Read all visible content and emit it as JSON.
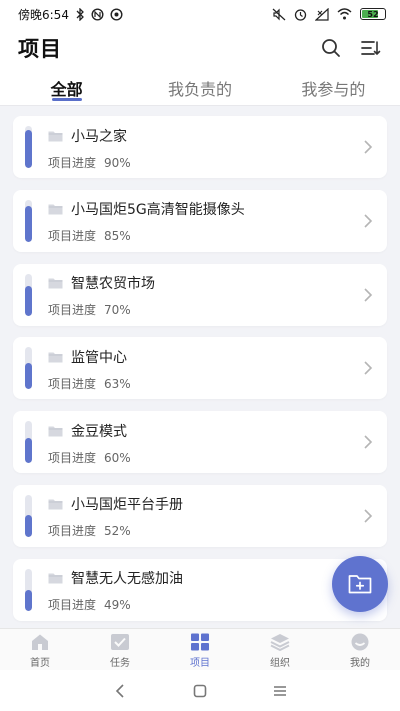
{
  "status_bar": {
    "time": "傍晚6:54",
    "battery": "52"
  },
  "header": {
    "title": "项目"
  },
  "tabs": [
    {
      "label": "全部",
      "active": true
    },
    {
      "label": "我负责的",
      "active": false
    },
    {
      "label": "我参与的",
      "active": false
    }
  ],
  "projects": [
    {
      "name": "小马之家",
      "progress_label": "项目进度",
      "progress": "90%",
      "progress_value": 90
    },
    {
      "name": "小马国炬5G高清智能摄像头",
      "progress_label": "项目进度",
      "progress": "85%",
      "progress_value": 85
    },
    {
      "name": "智慧农贸市场",
      "progress_label": "项目进度",
      "progress": "70%",
      "progress_value": 70
    },
    {
      "name": "监管中心",
      "progress_label": "项目进度",
      "progress": "63%",
      "progress_value": 63
    },
    {
      "name": "金豆模式",
      "progress_label": "项目进度",
      "progress": "60%",
      "progress_value": 60
    },
    {
      "name": "小马国炬平台手册",
      "progress_label": "项目进度",
      "progress": "52%",
      "progress_value": 52
    },
    {
      "name": "智慧无人无感加油",
      "progress_label": "项目进度",
      "progress": "49%",
      "progress_value": 49
    }
  ],
  "bottom_nav": [
    {
      "label": "首页",
      "icon": "home-icon",
      "active": false
    },
    {
      "label": "任务",
      "icon": "task-icon",
      "active": false
    },
    {
      "label": "项目",
      "icon": "project-icon",
      "active": true
    },
    {
      "label": "组织",
      "icon": "organization-icon",
      "active": false
    },
    {
      "label": "我的",
      "icon": "profile-icon",
      "active": false
    }
  ],
  "colors": {
    "accent": "#5f73cf",
    "progress_track": "#e4e6ee",
    "background": "#f2f3f7"
  }
}
